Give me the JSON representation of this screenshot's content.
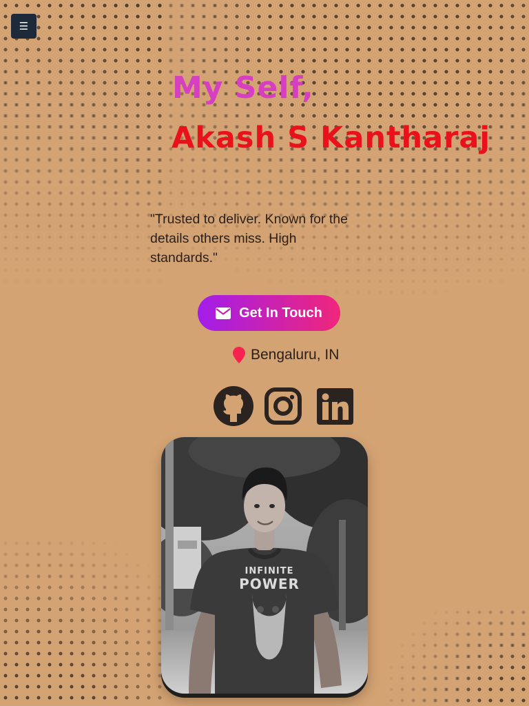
{
  "menu": {
    "icon_glyph": "☰",
    "icon": "hamburger-menu-icon"
  },
  "hero": {
    "greeting": "My Self,",
    "name": "Akash S Kantharaj",
    "tagline": "\"Trusted to deliver. Known for the details others miss. High standards.\""
  },
  "cta": {
    "label": "Get In Touch",
    "icon": "envelope-icon"
  },
  "location": {
    "text": "Bengaluru, IN",
    "icon": "map-pin-icon"
  },
  "social": [
    {
      "name": "GitHub",
      "icon": "github-icon"
    },
    {
      "name": "Instagram",
      "icon": "instagram-icon"
    },
    {
      "name": "LinkedIn",
      "icon": "linkedin-icon"
    }
  ],
  "profile_photo": {
    "shirt_line1": "INFINITE",
    "shirt_line2": "POWER"
  },
  "colors": {
    "background": "#d4a373",
    "greeting": "#d63fbf",
    "name": "#e8111c",
    "cta_gradient_start": "#a21dea",
    "cta_gradient_end": "#f0267a",
    "pin": "#f5234e",
    "menu_button": "#1e2a3a",
    "icon_dark": "#2b2320"
  }
}
